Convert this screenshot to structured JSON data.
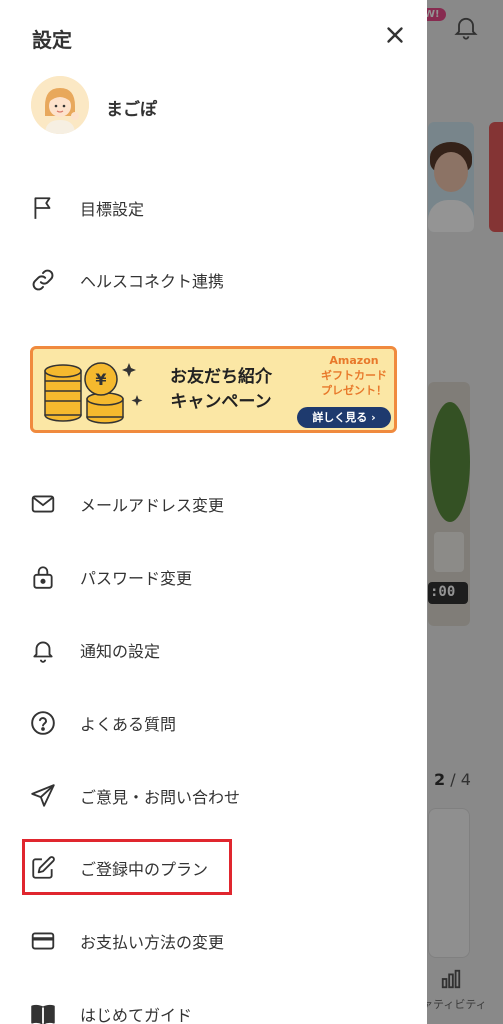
{
  "drawer": {
    "title": "設定",
    "user": {
      "name": "まごぽ"
    },
    "menu_top": [
      {
        "label": "目標設定",
        "icon": "flag-icon"
      },
      {
        "label": "ヘルスコネクト連携",
        "icon": "link-icon"
      }
    ],
    "banner": {
      "headline_line1": "お友だち紹介",
      "headline_line2": "キャンペーン",
      "amazon_line1": "Amazon",
      "amazon_line2": "ギフトカード",
      "amazon_line3": "プレゼント！",
      "detail_button": "詳しく見る ›"
    },
    "menu_bottom": [
      {
        "label": "メールアドレス変更",
        "icon": "mail-icon"
      },
      {
        "label": "パスワード変更",
        "icon": "lock-icon"
      },
      {
        "label": "通知の設定",
        "icon": "bell-icon"
      },
      {
        "label": "よくある質問",
        "icon": "question-icon"
      },
      {
        "label": "ご意見・お問い合わせ",
        "icon": "send-icon"
      },
      {
        "label": "ご登録中のプラン",
        "icon": "edit-icon"
      },
      {
        "label": "お支払い方法の変更",
        "icon": "credit-card-icon"
      },
      {
        "label": "はじめてガイド",
        "icon": "book-icon"
      }
    ]
  },
  "background": {
    "new_badge": "W!",
    "video_time": ":00",
    "pager_current": "2",
    "pager_total": "/ 4",
    "tab_label": "ァティビティ"
  },
  "colors": {
    "highlight": "#e0262e",
    "banner_border": "#f08a3e",
    "banner_bg": "#fbe7a5",
    "button_navy": "#1e3a6e"
  }
}
